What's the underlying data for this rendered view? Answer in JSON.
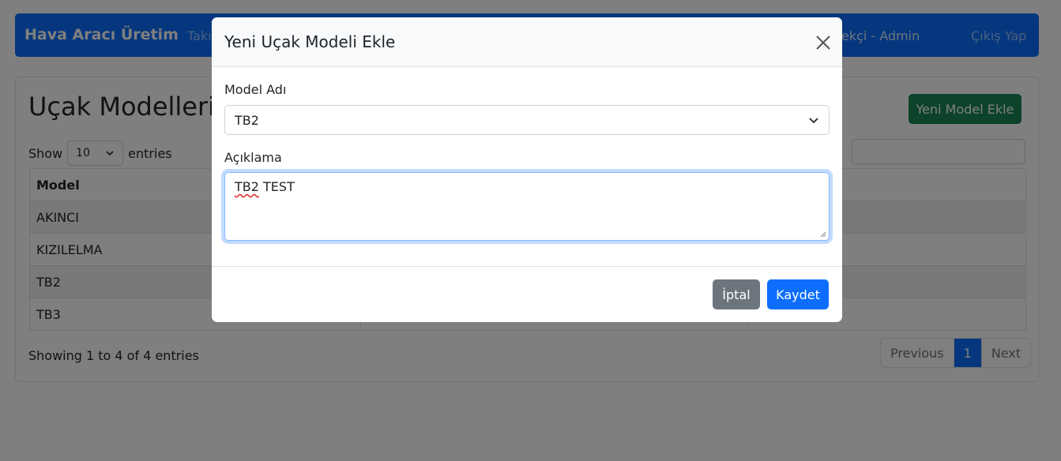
{
  "navbar": {
    "brand": "Hava Aracı Üretim",
    "link_partial": "Takı",
    "user_partial": "tafa Tüfekçi - Admin",
    "logout": "Çıkış Yap"
  },
  "page": {
    "title": "Uçak Modelleri",
    "new_model_button": "Yeni Model Ekle",
    "show_label": "Show",
    "length_value": "10",
    "entries_label": "entries",
    "search_label_partial": ":",
    "table": {
      "headers": [
        "Model",
        "",
        ""
      ],
      "rows": [
        [
          "AKINCI",
          "",
          ""
        ],
        [
          "KIZILELMA",
          "",
          ""
        ],
        [
          "TB2",
          "",
          ""
        ],
        [
          "TB3",
          "",
          ""
        ]
      ]
    },
    "info": "Showing 1 to 4 of 4 entries",
    "pagination": {
      "previous": "Previous",
      "current": "1",
      "next": "Next"
    }
  },
  "modal": {
    "title": "Yeni Uçak Modeli Ekle",
    "model_label": "Model Adı",
    "model_value": "TB2",
    "desc_label": "Açıklama",
    "desc_value_word1": "TB2",
    "desc_value_word2": " TEST",
    "cancel": "İptal",
    "save": "Kaydet"
  },
  "colors": {
    "primary": "#0d6efd",
    "success": "#198754",
    "secondary": "#6c757d"
  },
  "icons": [
    "close-icon",
    "chevron-down-icon"
  ]
}
